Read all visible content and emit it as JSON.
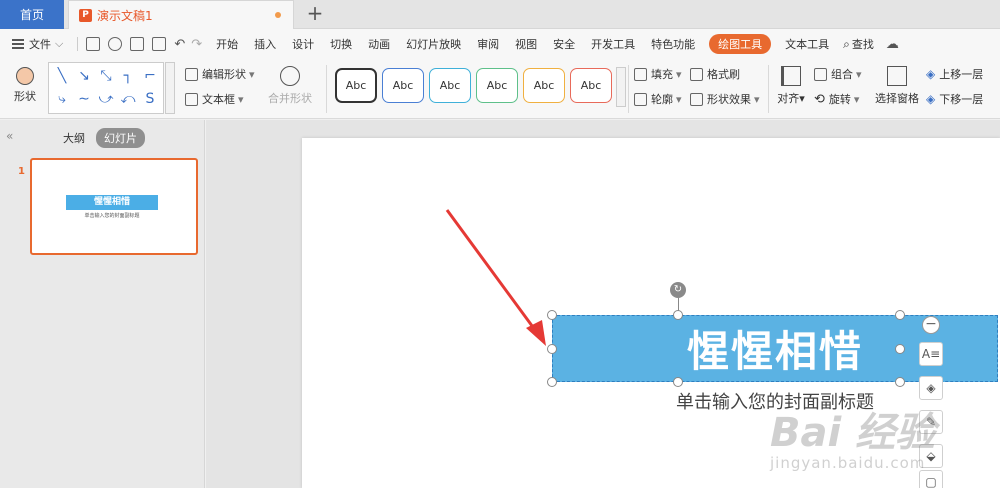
{
  "tabs": {
    "home": "首页",
    "doc_icon": "P",
    "doc_title": "演示文稿1",
    "add": "+"
  },
  "menu": {
    "file": "文件",
    "tabs": [
      "开始",
      "插入",
      "设计",
      "切换",
      "动画",
      "幻灯片放映",
      "审阅",
      "视图",
      "安全",
      "开发工具",
      "特色功能",
      "绘图工具",
      "文本工具"
    ],
    "active_tab": "绘图工具",
    "search": "查找"
  },
  "ribbon": {
    "shape_label": "形状",
    "edit_shape": "编辑形状",
    "text_box": "文本框",
    "merge_shape": "合并形状",
    "style_labels": [
      "Abc",
      "Abc",
      "Abc",
      "Abc",
      "Abc",
      "Abc"
    ],
    "style_colors": [
      "#333333",
      "#4a7fd4",
      "#3fb0d9",
      "#5ec08a",
      "#f0b040",
      "#e86a5a"
    ],
    "fill": "填充",
    "format_painter": "格式刷",
    "outline": "轮廓",
    "shape_effects": "形状效果",
    "align": "对齐",
    "group": "组合",
    "rotate": "旋转",
    "selection_pane": "选择窗格",
    "bring_forward": "上移一层",
    "send_backward": "下移一层"
  },
  "left_pane": {
    "outline_tab": "大纲",
    "slides_tab": "幻灯片",
    "slide_number": "1",
    "thumb_title": "惺惺相惜",
    "thumb_subtitle": "单击输入您的封面副标题"
  },
  "slide": {
    "title": "惺惺相惜",
    "subtitle": "单击输入您的封面副标题"
  },
  "watermark": {
    "main": "Bai 经验",
    "sub": "jingyan.baidu.com"
  },
  "colors": {
    "accent": "#e8692f",
    "title_fill": "#5bb2e3",
    "arrow": "#e53935"
  }
}
